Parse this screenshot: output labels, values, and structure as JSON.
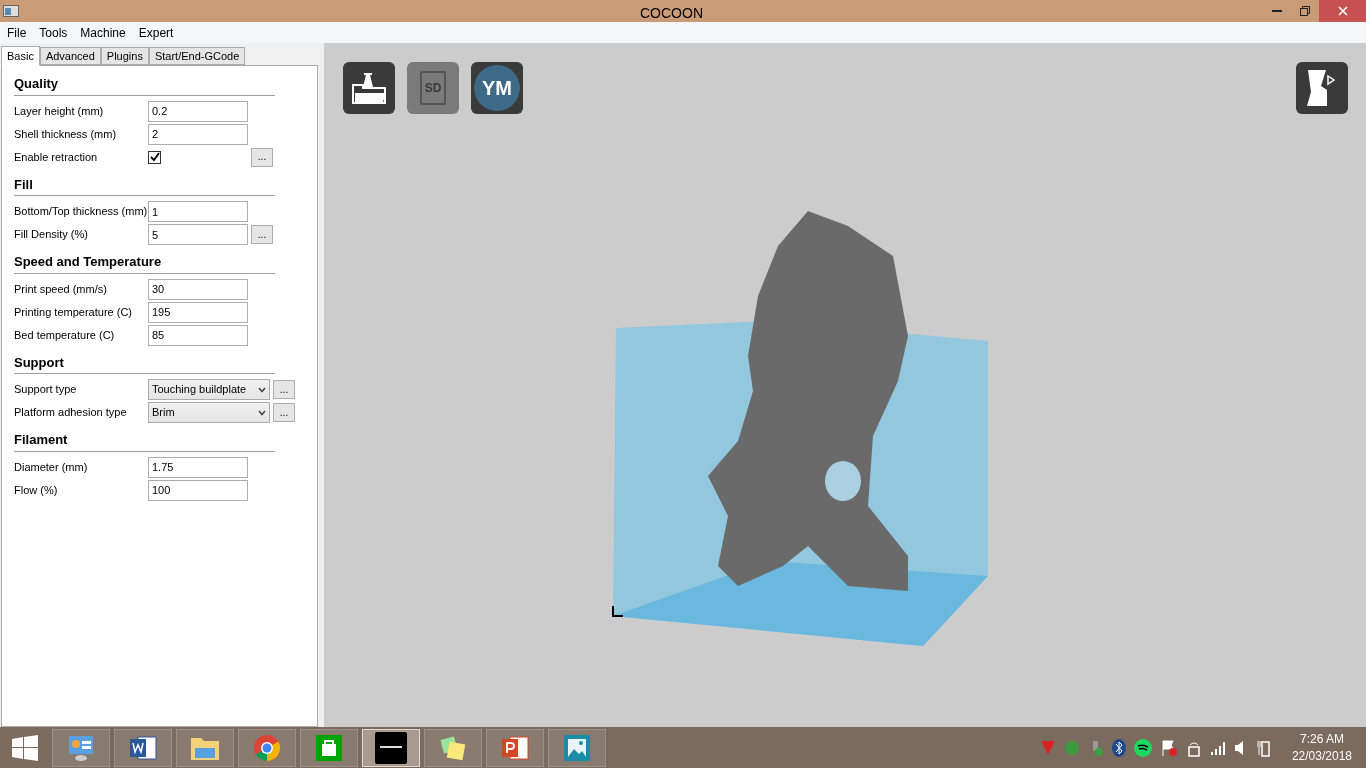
{
  "window": {
    "title": "COCOON"
  },
  "menu": [
    "File",
    "Tools",
    "Machine",
    "Expert"
  ],
  "tabs": [
    {
      "label": "Basic",
      "selected": true
    },
    {
      "label": "Advanced",
      "selected": false
    },
    {
      "label": "Plugins",
      "selected": false
    },
    {
      "label": "Start/End-GCode",
      "selected": false
    }
  ],
  "sections": [
    {
      "title": "Quality",
      "rows": [
        {
          "kind": "text",
          "label": "Layer height (mm)",
          "value": "0.2"
        },
        {
          "kind": "text",
          "label": "Shell thickness (mm)",
          "value": "2"
        },
        {
          "kind": "checkbox",
          "label": "Enable retraction",
          "checked": true,
          "more": "..."
        }
      ]
    },
    {
      "title": "Fill",
      "rows": [
        {
          "kind": "text",
          "label": "Bottom/Top thickness (mm)",
          "value": "1"
        },
        {
          "kind": "text",
          "label": "Fill Density (%)",
          "value": "5",
          "more": "..."
        }
      ]
    },
    {
      "title": "Speed and Temperature",
      "rows": [
        {
          "kind": "text",
          "label": "Print speed (mm/s)",
          "value": "30"
        },
        {
          "kind": "text",
          "label": "Printing temperature (C)",
          "value": "195"
        },
        {
          "kind": "text",
          "label": "Bed temperature (C)",
          "value": "85"
        }
      ]
    },
    {
      "title": "Support",
      "rows": [
        {
          "kind": "select",
          "label": "Support type",
          "value": "Touching buildplate",
          "more": "..."
        },
        {
          "kind": "select",
          "label": "Platform adhesion type",
          "value": "Brim",
          "more": "..."
        }
      ]
    },
    {
      "title": "Filament",
      "rows": [
        {
          "kind": "text",
          "label": "Diameter (mm)",
          "value": "1.75"
        },
        {
          "kind": "text",
          "label": "Flow (%)",
          "value": "100"
        }
      ]
    }
  ],
  "toolbar": [
    {
      "kind": "load",
      "disabled": false
    },
    {
      "kind": "sd",
      "text": "SD",
      "disabled": true
    },
    {
      "kind": "ym",
      "text": "YM",
      "disabled": false
    }
  ],
  "taskbar": [
    {
      "kind": "control-panel",
      "selected": false
    },
    {
      "kind": "word",
      "selected": false
    },
    {
      "kind": "folder",
      "selected": false
    },
    {
      "kind": "chrome",
      "selected": false
    },
    {
      "kind": "store",
      "selected": false
    },
    {
      "kind": "cocoon",
      "selected": true
    },
    {
      "kind": "notes",
      "selected": false
    },
    {
      "kind": "powerpoint",
      "selected": false
    },
    {
      "kind": "photos",
      "selected": false
    }
  ],
  "clock": {
    "time": "7:26 AM",
    "date": "22/03/2018"
  }
}
